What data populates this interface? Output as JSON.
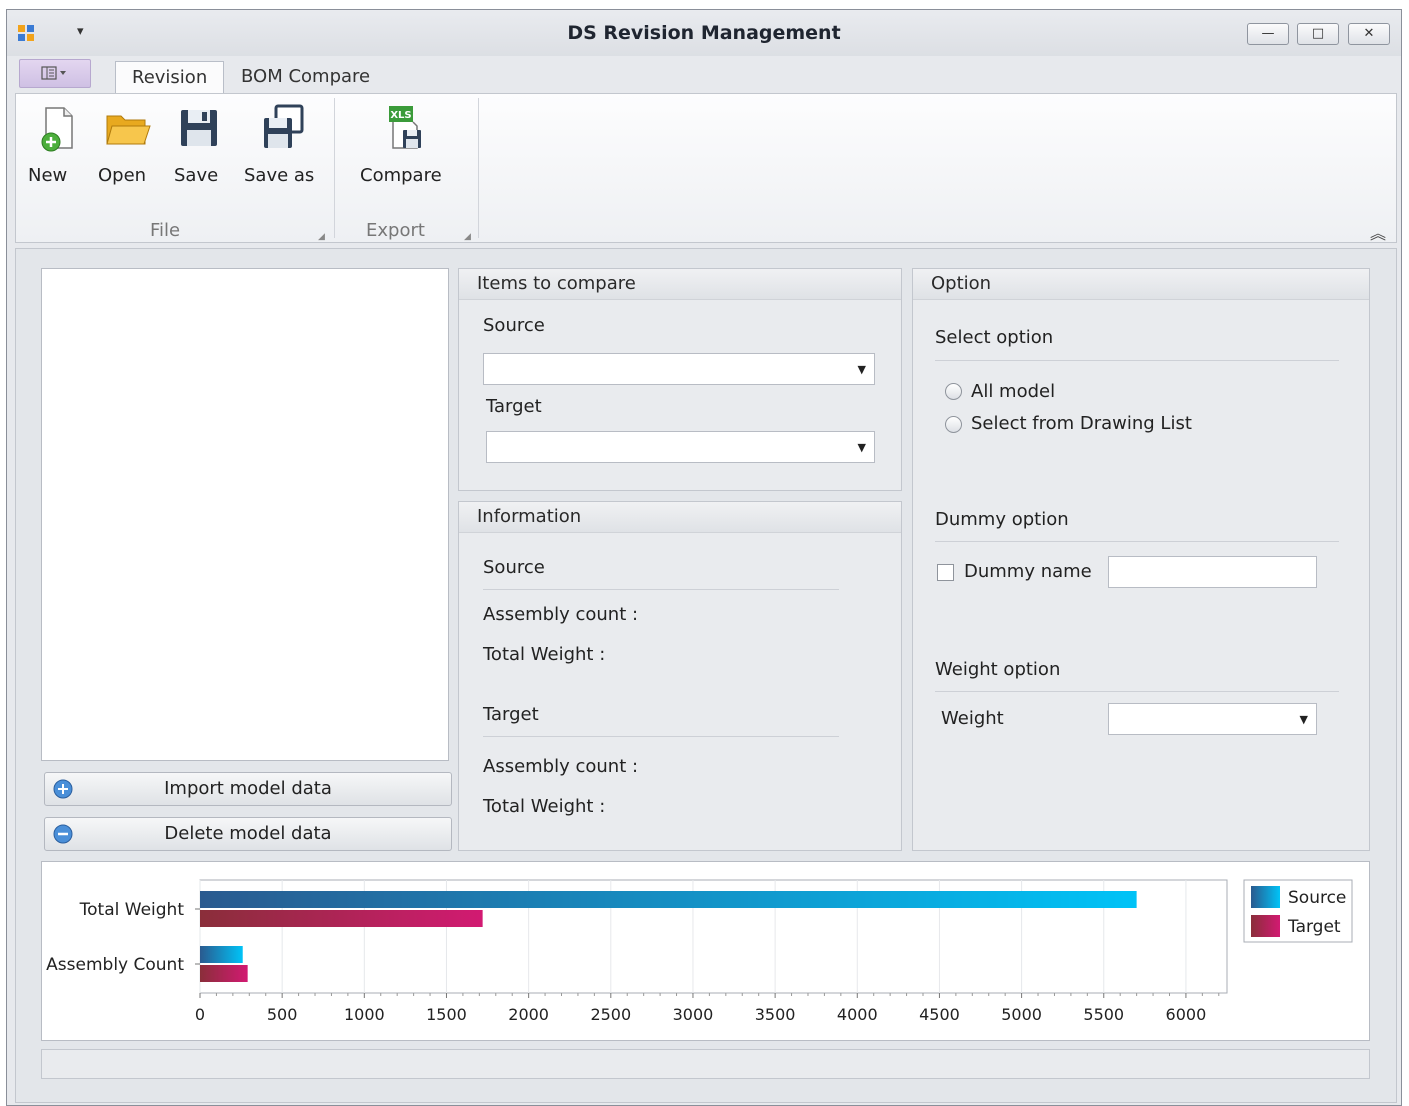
{
  "window": {
    "title": "DS Revision Management",
    "minimize": "—",
    "restore": "□",
    "close": "✕"
  },
  "tabs": [
    {
      "label": "Revision",
      "active": true
    },
    {
      "label": "BOM Compare",
      "active": false
    }
  ],
  "ribbon": {
    "file_group": "File",
    "export_group": "Export",
    "buttons": {
      "new": "New",
      "open": "Open",
      "save": "Save",
      "save_as": "Save as",
      "compare": "Compare"
    },
    "xls_badge": "XLS"
  },
  "items_to_compare": {
    "header": "Items to compare",
    "source_label": "Source",
    "source_value": "",
    "target_label": "Target",
    "target_value": ""
  },
  "information": {
    "header": "Information",
    "source_label": "Source",
    "source_assembly_count": "Assembly count :",
    "source_total_weight": "Total Weight :",
    "target_label": "Target",
    "target_assembly_count": "Assembly count :",
    "target_total_weight": "Total Weight :"
  },
  "option": {
    "header": "Option",
    "select_option": "Select option",
    "all_model": "All model",
    "select_from_drawing_list": "Select from Drawing List",
    "dummy_option": "Dummy option",
    "dummy_name": "Dummy name",
    "dummy_name_value": "",
    "weight_option": "Weight option",
    "weight_label": "Weight",
    "weight_value": ""
  },
  "actions": {
    "import": "Import model data",
    "delete": "Delete model data"
  },
  "chart_data": {
    "type": "bar",
    "orientation": "horizontal",
    "categories": [
      "Total Weight",
      "Assembly Count"
    ],
    "series": [
      {
        "name": "Source",
        "values": [
          5700,
          260
        ],
        "color": "#1c9ad6"
      },
      {
        "name": "Target",
        "values": [
          1720,
          290
        ],
        "color": "#b2245e"
      }
    ],
    "xlim": [
      0,
      6250
    ],
    "xticks": [
      0,
      500,
      1000,
      1500,
      2000,
      2500,
      3000,
      3500,
      4000,
      4500,
      5000,
      5500,
      6000
    ],
    "grid": true,
    "legend": "right"
  }
}
